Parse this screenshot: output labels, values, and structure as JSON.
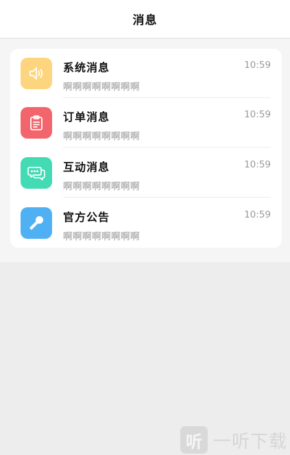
{
  "header": {
    "title": "消息"
  },
  "messages": [
    {
      "title": "系统消息",
      "time": "10:59",
      "preview": "啊啊啊啊啊啊啊啊",
      "icon": "speaker-icon",
      "color": "#fdd57e"
    },
    {
      "title": "订单消息",
      "time": "10:59",
      "preview": "啊啊啊啊啊啊啊啊",
      "icon": "clipboard-icon",
      "color": "#f3656c"
    },
    {
      "title": "互动消息",
      "time": "10:59",
      "preview": "啊啊啊啊啊啊啊啊",
      "icon": "chat-bubbles-icon",
      "color": "#42dbb4"
    },
    {
      "title": "官方公告",
      "time": "10:59",
      "preview": "啊啊啊啊啊啊啊啊",
      "icon": "microphone-icon",
      "color": "#4fb1f4"
    }
  ],
  "watermark": {
    "icon_char": "听",
    "text": "一听下载"
  }
}
